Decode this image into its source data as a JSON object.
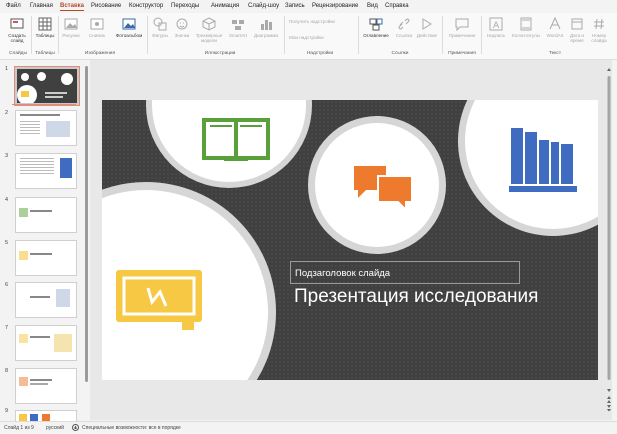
{
  "menu": {
    "items": [
      "Файл",
      "Главная",
      "Вставка",
      "Рисование",
      "Конструктор",
      "Переходы",
      "Анимация",
      "Слайд-шоу",
      "Запись",
      "Рецензирование",
      "Вид",
      "Справка"
    ],
    "active_index": 2
  },
  "ribbon": {
    "new_slide": "Создать слайд",
    "tables": "Таблицы",
    "pictures": "Рисунки",
    "screenshot": "Снимок",
    "photo_album": "Фотоальбом",
    "shapes": "Фигуры",
    "icons": "Значки",
    "models_3d": "Трехмерные модели",
    "smartart": "SmartArt",
    "chart": "Диаграмма",
    "get_addins": "Получить надстройки",
    "my_addins": "Мои надстройки",
    "zoom": "Оглавление",
    "link": "Ссылка",
    "action": "Действие",
    "comment": "Примечание",
    "textbox": "Надпись",
    "header_footer": "Колонтитулы",
    "wordart": "WordArt",
    "datetime": "Дата и время",
    "slide_number": "Номер слайда",
    "groups": {
      "slides": "Слайды",
      "tables": "Таблицы",
      "images": "Изображения",
      "illustrations": "Иллюстрации",
      "addins": "Надстройки",
      "links": "Ссылки",
      "comments": "Примечания",
      "text": "Текст"
    }
  },
  "thumbnails": {
    "numbers": [
      "1",
      "2",
      "3",
      "4",
      "5",
      "6",
      "7",
      "8",
      "9"
    ]
  },
  "slide": {
    "subtitle": "Подзаголовок слайда",
    "title": "Презентация исследования",
    "colors": {
      "background": "#404040",
      "book": "#5aa03a",
      "chat": "#ee7a2e",
      "books_blue": "#3f6cc0",
      "board_yellow": "#f6c844"
    }
  },
  "statusbar": {
    "slide_info": "Слайд 1 из 9",
    "language": "русский",
    "accessibility": "Специальные возможности: все в порядке"
  }
}
